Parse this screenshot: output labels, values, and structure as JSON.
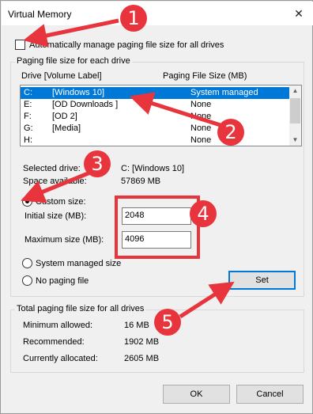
{
  "window": {
    "title": "Virtual Memory",
    "close_glyph": "✕"
  },
  "auto_manage": {
    "label": "Automatically manage paging file size for all drives",
    "checked": false
  },
  "paging_group": {
    "legend": "Paging file size for each drive",
    "headers": {
      "drive": "Drive  [Volume Label]",
      "size": "Paging File Size (MB)"
    },
    "drives": [
      {
        "drive": "C:",
        "label": "[Windows 10]",
        "size": "System managed",
        "selected": true
      },
      {
        "drive": "E:",
        "label": "[OD Downloads ]",
        "size": "None"
      },
      {
        "drive": "F:",
        "label": "[OD 2]",
        "size": "None"
      },
      {
        "drive": "G:",
        "label": "[Media]",
        "size": "None"
      },
      {
        "drive": "H:",
        "label": "",
        "size": "None"
      }
    ],
    "selected_drive_label": "Selected drive:",
    "selected_drive_value": "C:  [Windows 10]",
    "space_available_label": "Space available:",
    "space_available_value": "57869 MB",
    "custom_size_label": "Custom size:",
    "initial_size_label": "Initial size (MB):",
    "initial_size_value": "2048",
    "maximum_size_label": "Maximum size (MB):",
    "maximum_size_value": "4096",
    "system_managed_label": "System managed size",
    "no_paging_label": "No paging file",
    "set_button": "Set"
  },
  "total_group": {
    "legend": "Total paging file size for all drives",
    "minimum_label": "Minimum allowed:",
    "minimum_value": "16 MB",
    "recommended_label": "Recommended:",
    "recommended_value": "1902 MB",
    "allocated_label": "Currently allocated:",
    "allocated_value": "2605 MB"
  },
  "footer": {
    "ok": "OK",
    "cancel": "Cancel"
  },
  "annotations": {
    "color": "#e8343c",
    "badges": [
      "1",
      "2",
      "3",
      "4",
      "5"
    ]
  }
}
